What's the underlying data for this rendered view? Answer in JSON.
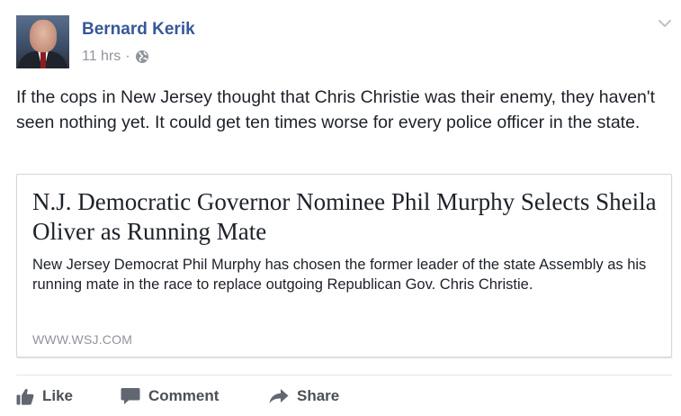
{
  "post": {
    "author": "Bernard Kerik",
    "timestamp": "11 hrs",
    "separator": "·",
    "privacy_icon": "globe-icon",
    "menu_icon": "chevron-down-icon",
    "text": "If the cops in New Jersey thought that Chris Christie was their enemy, they haven't seen nothing yet. It could get ten times worse for every police officer in the state."
  },
  "link": {
    "title": "N.J. Democratic Governor Nominee Phil Murphy Selects Sheila Oliver as Running Mate",
    "description": "New Jersey Democrat Phil Murphy has chosen the former leader of the state Assembly as his running mate in the race to replace outgoing Republican Gov. Chris Christie.",
    "domain": "WWW.WSJ.COM"
  },
  "actions": {
    "like": {
      "label": "Like",
      "icon": "thumbs-up-icon"
    },
    "comment": {
      "label": "Comment",
      "icon": "comment-icon"
    },
    "share": {
      "label": "Share",
      "icon": "share-arrow-icon"
    }
  },
  "colors": {
    "author_link": "#365899",
    "meta_gray": "#90949c",
    "action_gray": "#4b4f56",
    "text": "#1d2129"
  }
}
